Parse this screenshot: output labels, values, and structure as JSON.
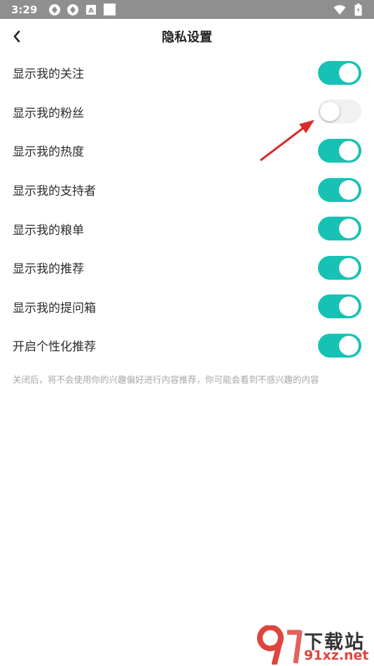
{
  "status_bar": {
    "time": "3:29",
    "icons_left": [
      "vpn-icon",
      "vpn-icon-2",
      "a-icon",
      "square-icon"
    ],
    "icons_right": [
      "wifi-icon",
      "battery-icon"
    ]
  },
  "header": {
    "title": "隐私设置",
    "back_icon": "chevron-left-icon"
  },
  "settings": [
    {
      "label": "显示我的关注",
      "enabled": true
    },
    {
      "label": "显示我的粉丝",
      "enabled": false
    },
    {
      "label": "显示我的热度",
      "enabled": true
    },
    {
      "label": "显示我的支持者",
      "enabled": true
    },
    {
      "label": "显示我的粮单",
      "enabled": true
    },
    {
      "label": "显示我的推荐",
      "enabled": true
    },
    {
      "label": "显示我的提问箱",
      "enabled": true
    },
    {
      "label": "开启个性化推荐",
      "enabled": true
    }
  ],
  "note": "关闭后，将不会使用你的兴趣偏好进行内容推荐，你可能会看到不感兴趣的内容",
  "watermark": {
    "top_text": "下载站",
    "bottom_text": "91xz.net"
  },
  "colors": {
    "toggle_on": "#17c2b4",
    "toggle_off": "#f1f1f1",
    "annotation_arrow": "#d92b2b",
    "status_bar": "#8f8f8f"
  }
}
